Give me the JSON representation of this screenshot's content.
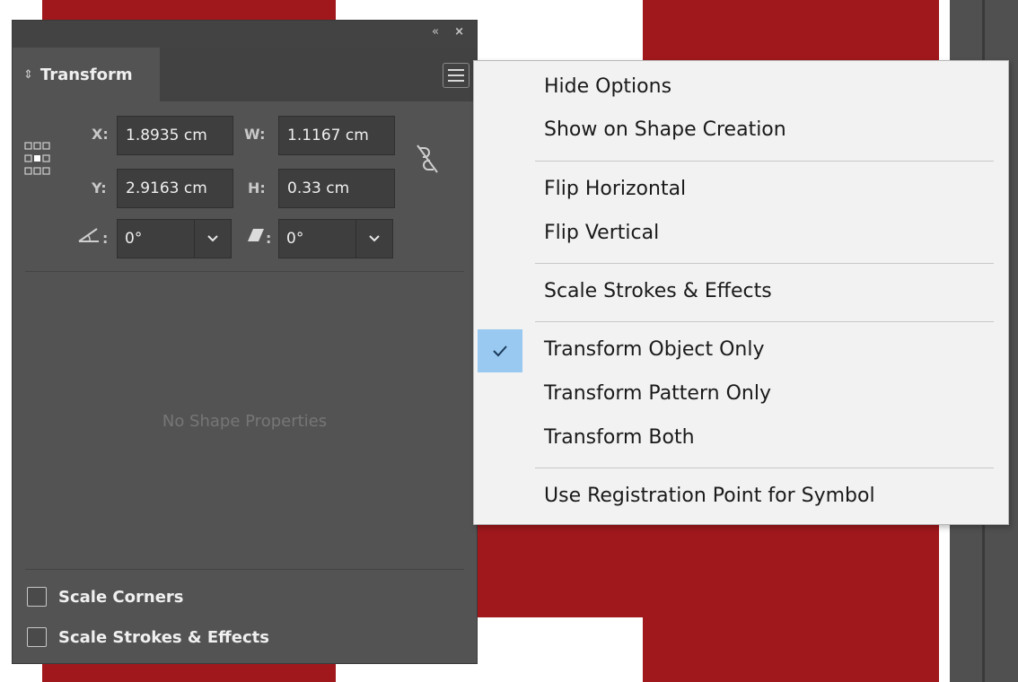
{
  "panel": {
    "title": "Transform",
    "collapse_glyph": "«",
    "close_glyph": "×",
    "x_label": "X:",
    "x_value": "1.8935 cm",
    "y_label": "Y:",
    "y_value": "2.9163 cm",
    "w_label": "W:",
    "w_value": "1.1167 cm",
    "h_label": "H:",
    "h_value": "0.33 cm",
    "rotate_label": ":",
    "rotate_value": "0°",
    "shear_label": ":",
    "shear_value": "0°",
    "no_shape_text": "No Shape Properties",
    "checkboxes": [
      {
        "label": "Scale Corners",
        "checked": false
      },
      {
        "label": "Scale Strokes & Effects",
        "checked": false
      }
    ]
  },
  "flyout_menu": {
    "items": [
      {
        "label": "Hide Options",
        "checked": false
      },
      {
        "label": "Show on Shape Creation",
        "checked": false
      },
      {
        "label": "Flip Horizontal",
        "checked": false
      },
      {
        "label": "Flip Vertical",
        "checked": false
      },
      {
        "label": "Scale Strokes & Effects",
        "checked": false
      },
      {
        "label": "Transform Object Only",
        "checked": true
      },
      {
        "label": "Transform Pattern Only",
        "checked": false
      },
      {
        "label": "Transform Both",
        "checked": false
      },
      {
        "label": "Use Registration Point for Symbol",
        "checked": false
      }
    ]
  },
  "colors": {
    "canvas_red": "#a0181c",
    "panel_bg": "#535353",
    "menu_bg": "#f2f2f2",
    "check_highlight": "#99c9f0"
  }
}
